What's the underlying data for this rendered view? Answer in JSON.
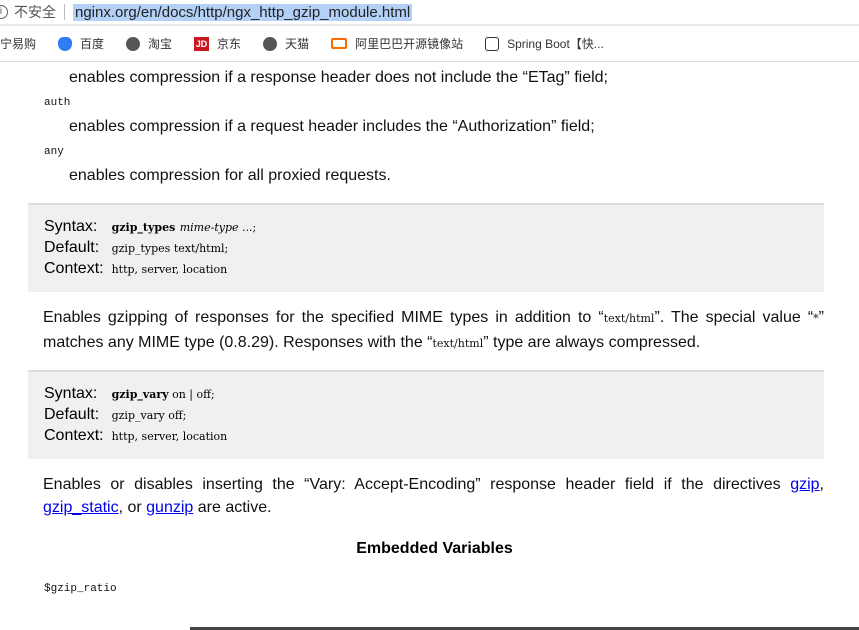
{
  "browser": {
    "security_label": "不安全",
    "url": "nginx.org/en/docs/http/ngx_http_gzip_module.html",
    "bookmarks": [
      {
        "label": "苏宁易购",
        "icon": "suning-icon"
      },
      {
        "label": "百度",
        "icon": "baidu-paw-icon"
      },
      {
        "label": "淘宝",
        "icon": "globe-icon"
      },
      {
        "label": "京东",
        "icon": "jd-icon"
      },
      {
        "label": "天猫",
        "icon": "globe-icon"
      },
      {
        "label": "阿里巴巴开源镜像站",
        "icon": "aliyun-icon"
      },
      {
        "label": "Spring Boot【快...",
        "icon": "spring-icon"
      }
    ]
  },
  "doc": {
    "etag_text": "enables compression if a response header does not include the “ETag” field;",
    "auth_term": "auth",
    "auth_text": "enables compression if a request header includes the “Authorization” field;",
    "any_term": "any",
    "any_text": "enables compression for all proxied requests.",
    "labels": {
      "syntax": "Syntax:",
      "default": "Default:",
      "context": "Context:"
    },
    "gzip_types": {
      "name": "gzip_types",
      "arg": "mime-type",
      "rest": " ...;",
      "default": "gzip_types text/html;",
      "context": "http, server, location"
    },
    "types_p1": "Enables gzipping of responses for the specified MIME types in addition to “",
    "types_code1": "text/html",
    "types_p2": "”. The special value “",
    "types_code2": "*",
    "types_p3": "” matches any MIME type (0.8.29). Responses with the “",
    "types_code3": "text/html",
    "types_p4": "” type are always compressed.",
    "gzip_vary": {
      "name": "gzip_vary",
      "rest": " on | off;",
      "default": "gzip_vary off;",
      "context": "http, server, location"
    },
    "vary_p1": "Enables or disables inserting the “Vary: Accept-Encoding” response header field if the directives ",
    "link_gzip": "gzip",
    "comma1": ", ",
    "link_gzip_static": "gzip_static",
    "or": ", or ",
    "link_gunzip": "gunzip",
    "vary_p2": " are active.",
    "embedded_heading": "Embedded Variables",
    "var1": "$gzip_ratio"
  }
}
